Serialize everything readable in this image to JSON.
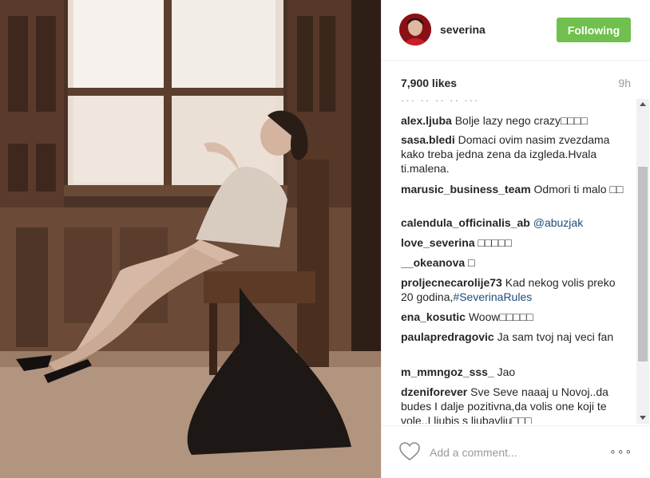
{
  "header": {
    "username": "severina",
    "follow_label": "Following",
    "follow_color": "#70c050"
  },
  "post": {
    "likes": "7,900 likes",
    "time": "9h"
  },
  "comments": [
    {
      "user": "alex.ljuba",
      "text": "Bolje lazy nego crazy□□□□"
    },
    {
      "user": "sasa.bledi",
      "text": "Domaci ovim nasim zvezdama kako treba jedna zena da izgleda.Hvala ti.malena."
    },
    {
      "user": "marusic_business_team",
      "text": "Odmori ti malo □□"
    },
    {
      "user": "calendula_officinalis_ab",
      "text": "@abuzjak"
    },
    {
      "user": "love_severina",
      "text": "□□□□□"
    },
    {
      "user": "__okeanova",
      "text": "□"
    },
    {
      "user": "proljecnecarolije73",
      "text": "Kad nekog volis preko 20 godina,",
      "link": "#SeverinaRules"
    },
    {
      "user": "ena_kosutic",
      "text": "Woow□□□□□"
    },
    {
      "user": "paulapredragovic",
      "text": "Ja sam tvoj naj veci fan"
    },
    {
      "user": "m_mmngoz_sss_",
      "text": "Jao"
    },
    {
      "user": "dzeniforever",
      "text": "Sve Seve naaaj u Novoj..da budes I dalje pozitivna,da volis one koji te vole..I liubis s liubavliu□□□"
    }
  ],
  "footer": {
    "comment_placeholder": "Add a comment...",
    "more_label": "∘∘∘"
  },
  "icons": {
    "heart": "heart-icon",
    "more": "more-options-icon",
    "avatar": "avatar"
  }
}
